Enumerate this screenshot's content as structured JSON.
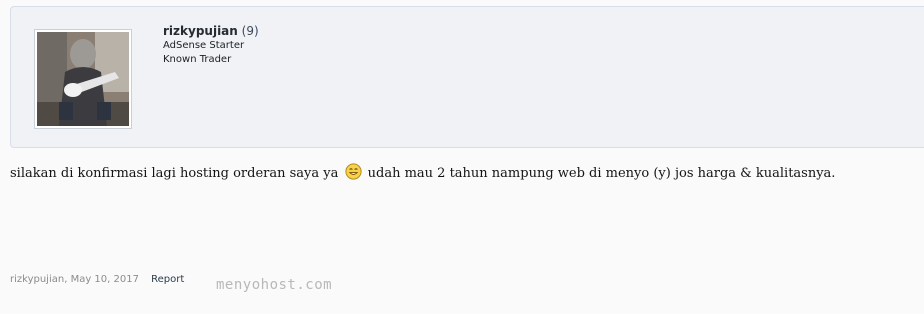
{
  "user": {
    "username": "rizkypujian",
    "trade_count": "(9)",
    "titles": [
      "AdSense Starter",
      "Known Trader"
    ]
  },
  "message": {
    "text_before": "silakan di konfirmasi lagi hosting orderan saya ya",
    "smilie_icon": "smile-emoji-icon",
    "text_after": "udah mau 2 tahun nampung web di menyo (y) jos harga & kualitasnya."
  },
  "meta": {
    "author": "rizkypujian",
    "separator": ",",
    "date": "May 10, 2017",
    "report_label": "Report"
  },
  "watermark": "menyohost.com",
  "colors": {
    "card_background": "#f0f2f5",
    "card_border": "#d7dee8",
    "meta_muted": "#8c8c8c"
  }
}
